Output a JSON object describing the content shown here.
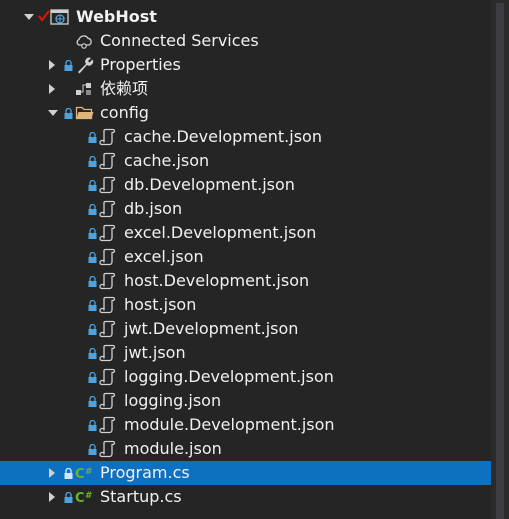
{
  "project": {
    "name": "WebHost",
    "children": {
      "connected_services": "Connected Services",
      "properties": "Properties",
      "dependencies": "依赖项",
      "config": {
        "label": "config",
        "files": [
          "cache.Development.json",
          "cache.json",
          "db.Development.json",
          "db.json",
          "excel.Development.json",
          "excel.json",
          "host.Development.json",
          "host.json",
          "jwt.Development.json",
          "jwt.json",
          "logging.Development.json",
          "logging.json",
          "module.Development.json",
          "module.json"
        ]
      },
      "program": "Program.cs",
      "startup": "Startup.cs"
    }
  },
  "colors": {
    "background": "#252526",
    "selection": "#0e70c0",
    "text": "#f1f1f1",
    "check_red": "#e51400",
    "lock_blue": "#4fa3e0",
    "folder_orange": "#dcb67a",
    "csharp_green": "#68b723"
  }
}
